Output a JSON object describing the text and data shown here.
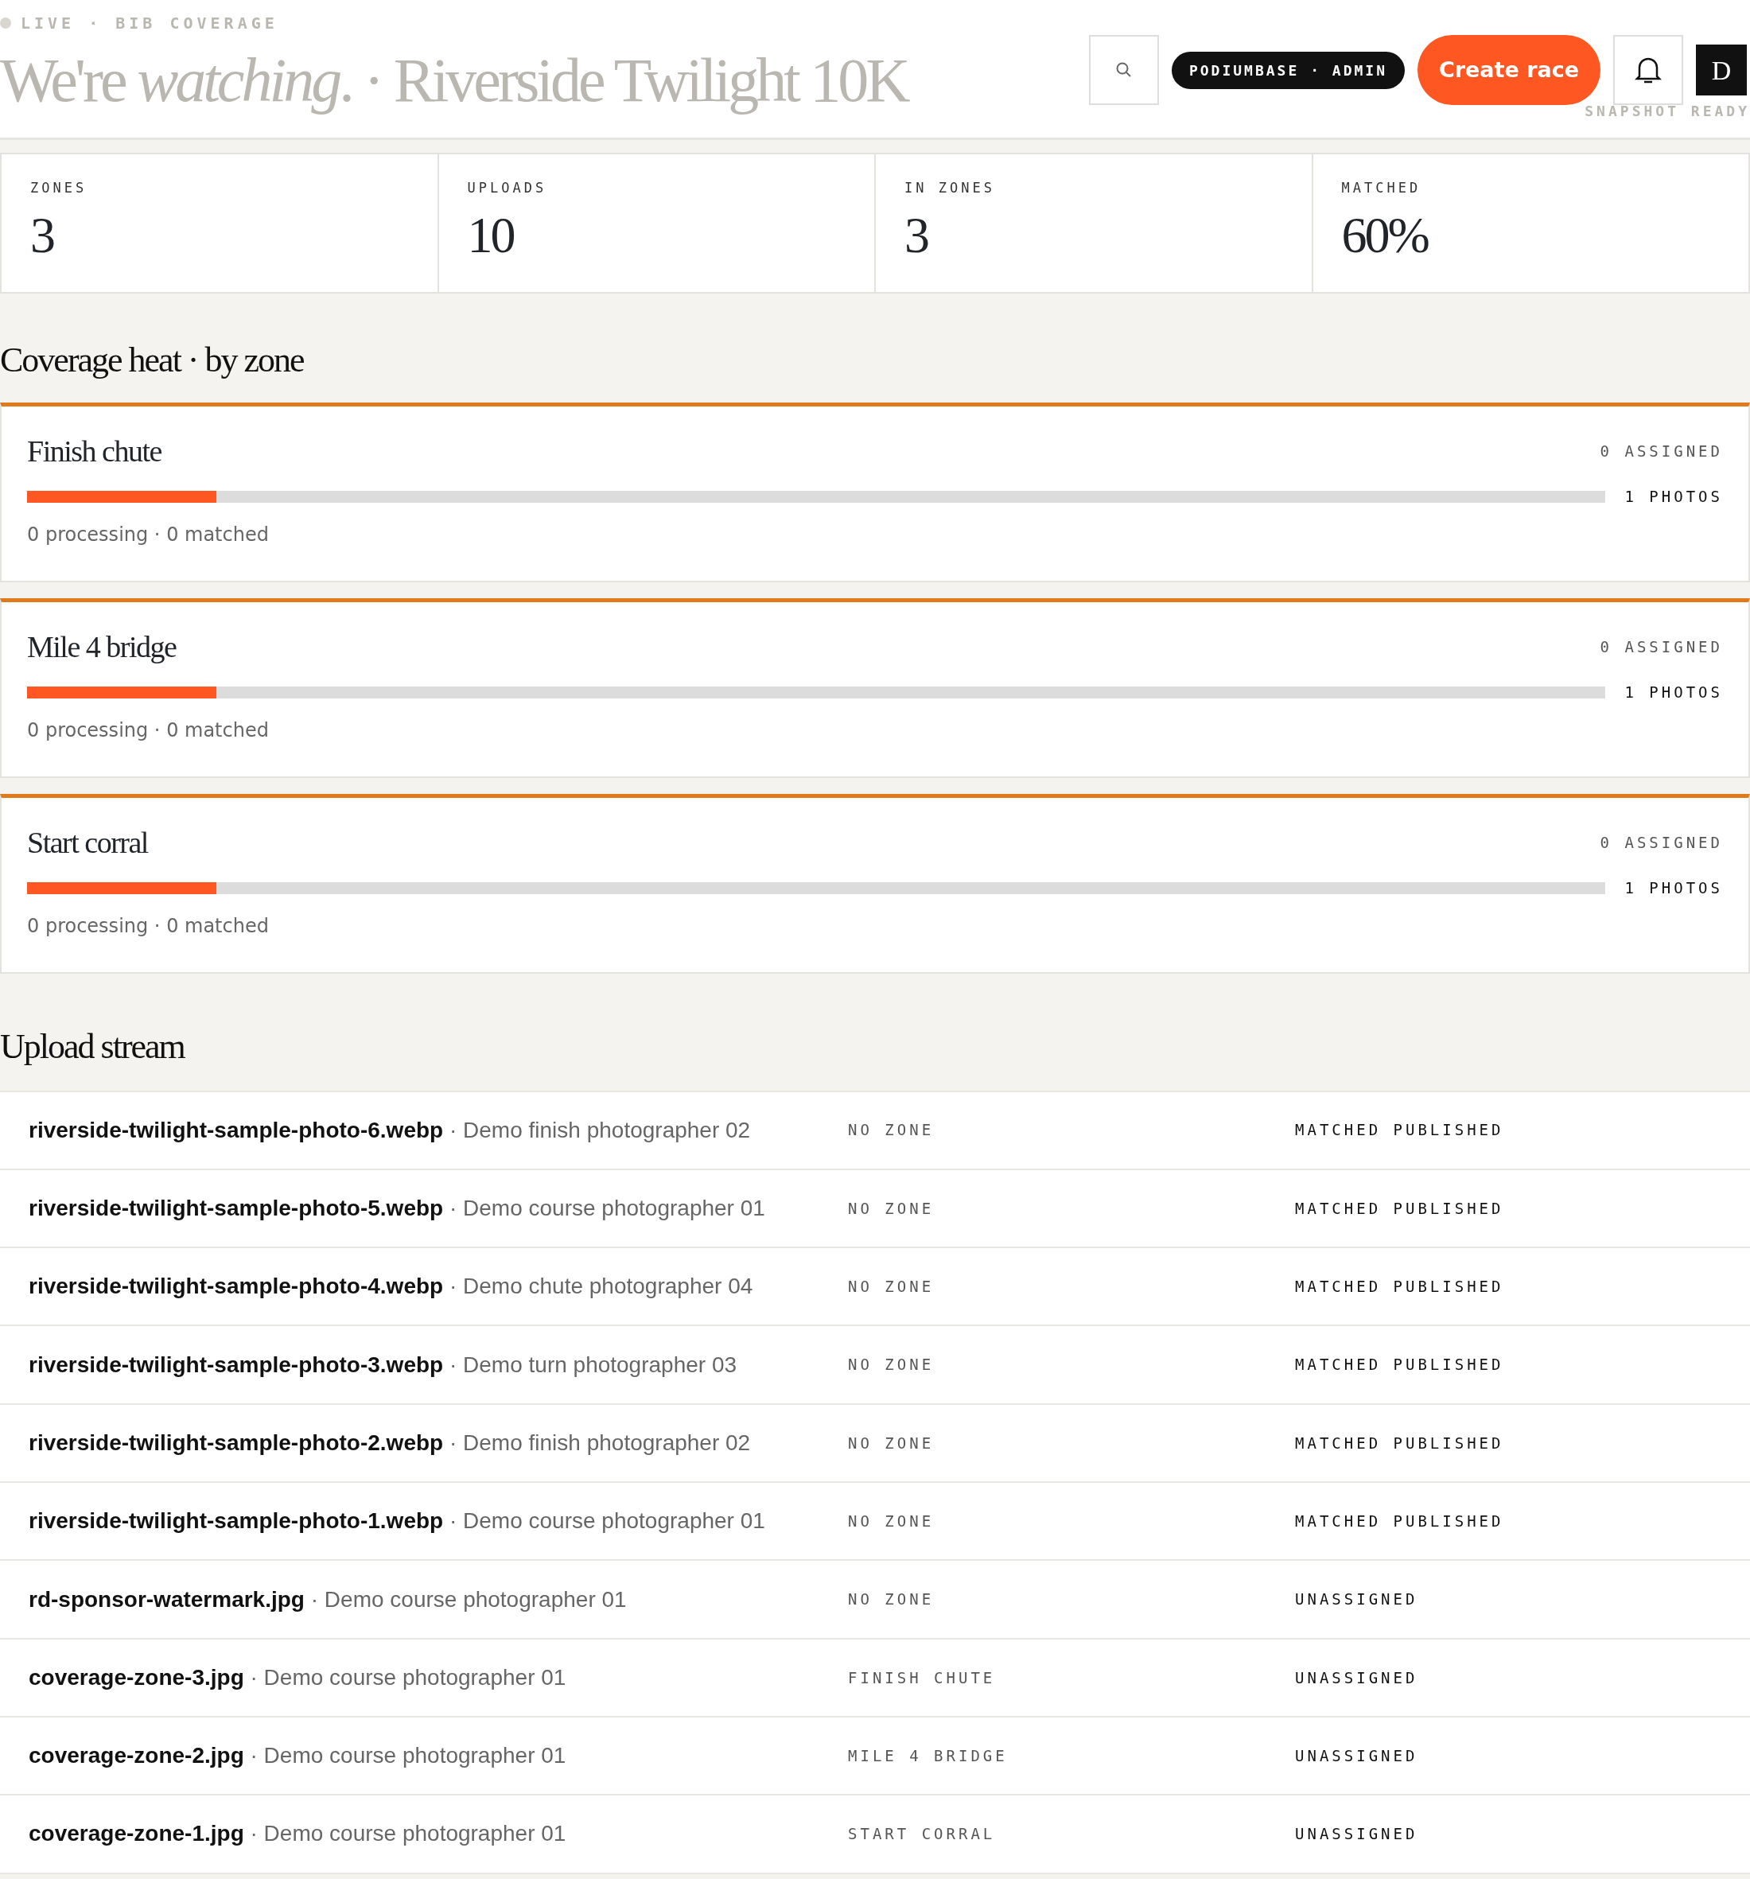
{
  "header": {
    "eyebrow": "LIVE · BIB COVERAGE",
    "title": "We're *watching*. · Riverside Twilight 10K",
    "badge": "PODIUMBASE · ADMIN",
    "create_button": "Create race",
    "avatar": "D",
    "status": "SNAPSHOT READY"
  },
  "stats": [
    {
      "label": "ZONES",
      "value": "3"
    },
    {
      "label": "UPLOADS",
      "value": "10"
    },
    {
      "label": "IN ZONES",
      "value": "3"
    },
    {
      "label": "MATCHED",
      "value": "60%"
    }
  ],
  "coverage": {
    "heading": "Coverage heat · by zone",
    "zones": [
      {
        "name": "Finish chute",
        "assigned": "0 ASSIGNED",
        "level": 0.12,
        "photos": "1 PHOTOS",
        "summary": "0 processing · 0 matched"
      },
      {
        "name": "Mile 4 bridge",
        "assigned": "0 ASSIGNED",
        "level": 0.12,
        "photos": "1 PHOTOS",
        "summary": "0 processing · 0 matched"
      },
      {
        "name": "Start corral",
        "assigned": "0 ASSIGNED",
        "level": 0.12,
        "photos": "1 PHOTOS",
        "summary": "0 processing · 0 matched"
      }
    ]
  },
  "uploads": {
    "heading": "Upload stream",
    "rows": [
      {
        "file": "riverside-twilight-sample-photo-6.webp",
        "photographer": "· Demo finish photographer 02",
        "zone": "NO ZONE",
        "status": "MATCHED PUBLISHED"
      },
      {
        "file": "riverside-twilight-sample-photo-5.webp",
        "photographer": "· Demo course photographer 01",
        "zone": "NO ZONE",
        "status": "MATCHED PUBLISHED"
      },
      {
        "file": "riverside-twilight-sample-photo-4.webp",
        "photographer": "· Demo chute photographer 04",
        "zone": "NO ZONE",
        "status": "MATCHED PUBLISHED"
      },
      {
        "file": "riverside-twilight-sample-photo-3.webp",
        "photographer": "· Demo turn photographer 03",
        "zone": "NO ZONE",
        "status": "MATCHED PUBLISHED"
      },
      {
        "file": "riverside-twilight-sample-photo-2.webp",
        "photographer": "· Demo finish photographer 02",
        "zone": "NO ZONE",
        "status": "MATCHED PUBLISHED"
      },
      {
        "file": "riverside-twilight-sample-photo-1.webp",
        "photographer": "· Demo course photographer 01",
        "zone": "NO ZONE",
        "status": "MATCHED PUBLISHED"
      },
      {
        "file": "rd-sponsor-watermark.jpg",
        "photographer": "· Demo course photographer 01",
        "zone": "NO ZONE",
        "status": "UNASSIGNED"
      },
      {
        "file": "coverage-zone-3.jpg",
        "photographer": "· Demo course photographer 01",
        "zone": "FINISH CHUTE",
        "status": "UNASSIGNED"
      },
      {
        "file": "coverage-zone-2.jpg",
        "photographer": "· Demo course photographer 01",
        "zone": "MILE 4 BRIDGE",
        "status": "UNASSIGNED"
      },
      {
        "file": "coverage-zone-1.jpg",
        "photographer": "· Demo course photographer 01",
        "zone": "START CORRAL",
        "status": "UNASSIGNED"
      }
    ]
  }
}
